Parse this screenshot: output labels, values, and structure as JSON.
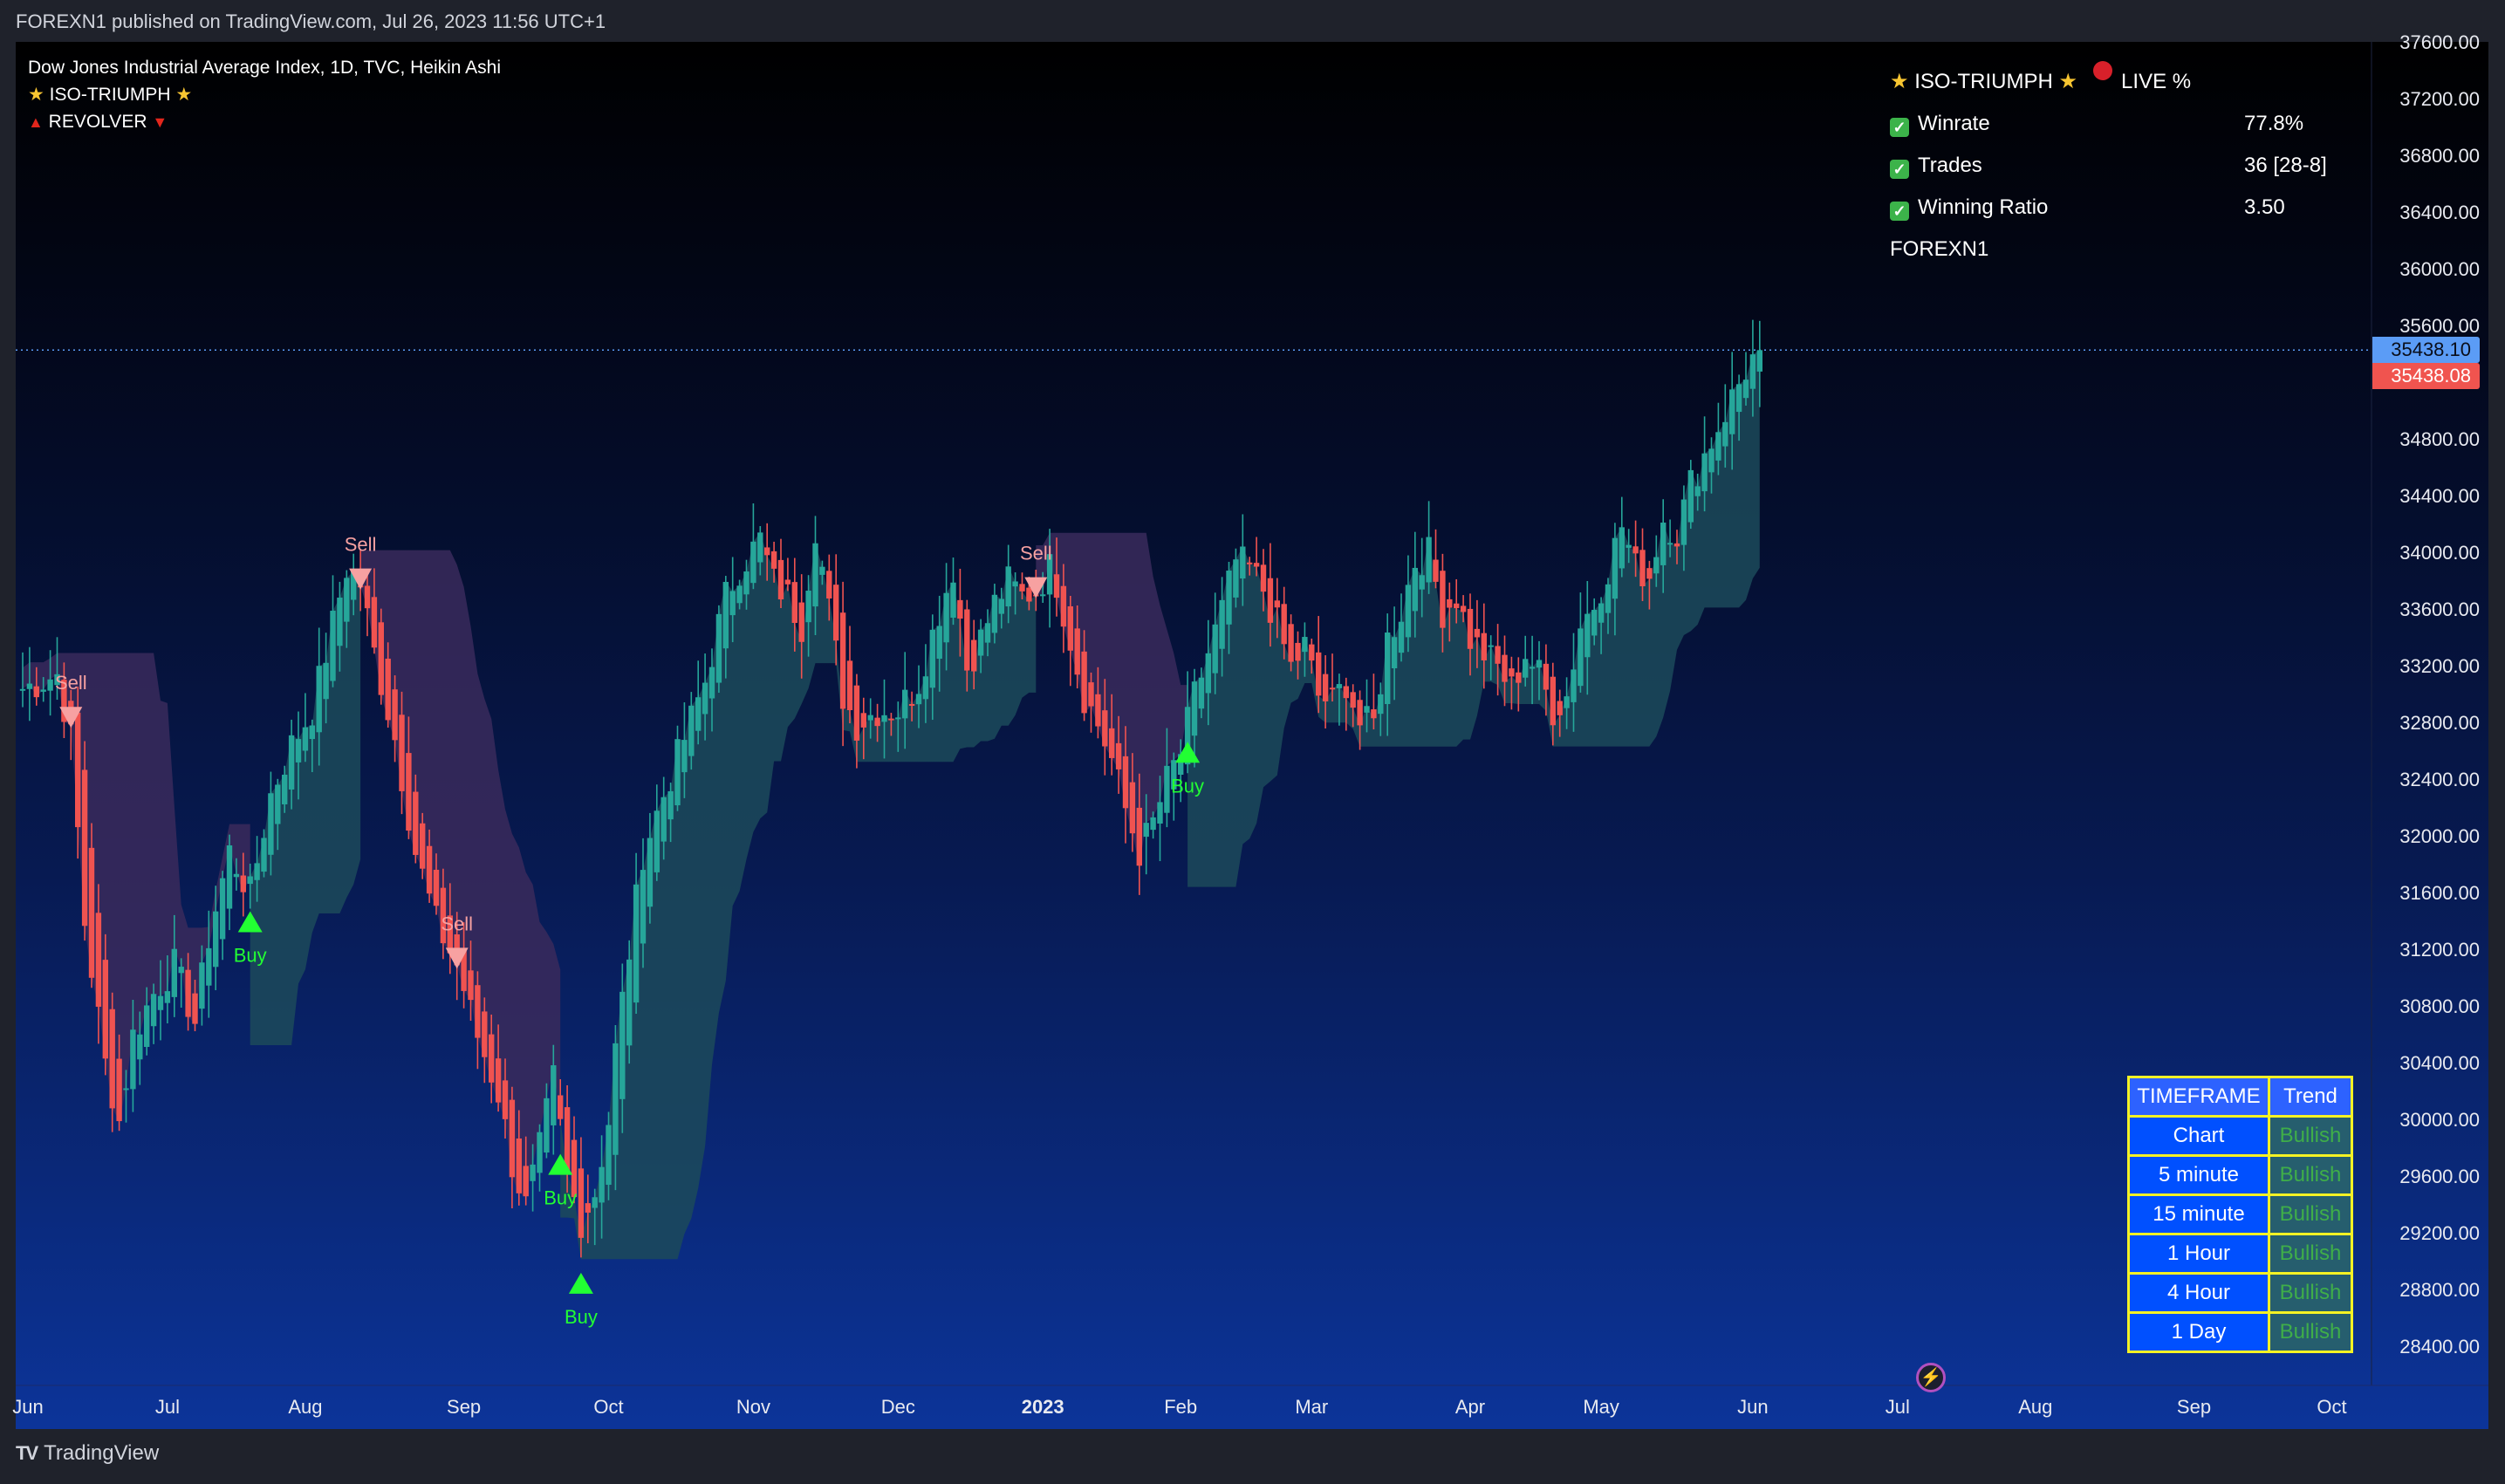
{
  "header": {
    "published": "FOREXN1 published on TradingView.com, Jul 26, 2023 11:56 UTC+1"
  },
  "legend": {
    "symbol": "Dow Jones Industrial Average Index, 1D, TVC, Heikin Ashi",
    "indicator1": "ISO-TRIUMPH",
    "indicator2": "REVOLVER"
  },
  "stats_panel": {
    "title": "ISO-TRIUMPH",
    "live_label": "LIVE %",
    "rows": [
      {
        "label": "Winrate",
        "value": "77.8%"
      },
      {
        "label": "Trades",
        "value": "36 [28-8]"
      },
      {
        "label": "Winning Ratio",
        "value": "3.50"
      }
    ],
    "author": "FOREXN1"
  },
  "trend_table": {
    "headers": [
      "TIMEFRAME",
      "Trend"
    ],
    "rows": [
      {
        "timeframe": "Chart",
        "trend": "Bullish"
      },
      {
        "timeframe": "5 minute",
        "trend": "Bullish"
      },
      {
        "timeframe": "15 minute",
        "trend": "Bullish"
      },
      {
        "timeframe": "1 Hour",
        "trend": "Bullish"
      },
      {
        "timeframe": "4 Hour",
        "trend": "Bullish"
      },
      {
        "timeframe": "1 Day",
        "trend": "Bullish"
      }
    ]
  },
  "price_badges": {
    "last": "35438.10",
    "last_color": "#5b9cf6",
    "ha_close": "35438.08",
    "ha_color": "#f0544f"
  },
  "footer": {
    "brand": "TradingView",
    "logo": "tv-logo-icon"
  },
  "colors": {
    "bull": "#26a69a",
    "bear": "#f05350",
    "sell_marker": "#f7a1a1",
    "buy_marker": "#22ff33",
    "bear_cloud": "#3a2a5c",
    "bull_cloud": "#1c4a5a",
    "table_border": "#f5f224"
  },
  "chart_data": {
    "type": "candlestick",
    "title": "Dow Jones Industrial Average Index, 1D, TVC, Heikin Ashi",
    "ylim": [
      28000,
      37700
    ],
    "y_ticks": [
      37600,
      37200,
      36800,
      36400,
      36000,
      35600,
      34800,
      34400,
      34000,
      33600,
      33200,
      32800,
      32400,
      32000,
      31600,
      31200,
      30800,
      30400,
      30000,
      29600,
      29200,
      28800,
      28400
    ],
    "y_tick_labels": [
      "37600.00",
      "37200.00",
      "36800.00",
      "36400.00",
      "36000.00",
      "35600.00",
      "34800.00",
      "34400.00",
      "34000.00",
      "33600.00",
      "33200.00",
      "32800.00",
      "32400.00",
      "32000.00",
      "31600.00",
      "31200.00",
      "30800.00",
      "30400.00",
      "30000.00",
      "29600.00",
      "29200.00",
      "28800.00",
      "28400.00"
    ],
    "x_labels": [
      {
        "label": "Jun",
        "bar": 0
      },
      {
        "label": "Jul",
        "bar": 21
      },
      {
        "label": "Aug",
        "bar": 41
      },
      {
        "label": "Sep",
        "bar": 64
      },
      {
        "label": "Oct",
        "bar": 85
      },
      {
        "label": "Nov",
        "bar": 106
      },
      {
        "label": "Dec",
        "bar": 127
      },
      {
        "label": "2023",
        "bar": 148,
        "bold": true
      },
      {
        "label": "Feb",
        "bar": 168
      },
      {
        "label": "Mar",
        "bar": 187
      },
      {
        "label": "Apr",
        "bar": 210
      },
      {
        "label": "May",
        "bar": 229
      },
      {
        "label": "Jun",
        "bar": 251
      },
      {
        "label": "Jul",
        "bar": 272
      },
      {
        "label": "Aug",
        "bar": 292
      },
      {
        "label": "Sep",
        "bar": 315
      },
      {
        "label": "Oct",
        "bar": 335
      }
    ],
    "total_bars": 345,
    "close_path": [
      [
        0,
        33050
      ],
      [
        5,
        33150
      ],
      [
        7,
        32700
      ],
      [
        9,
        31400
      ],
      [
        12,
        30400
      ],
      [
        14,
        30000
      ],
      [
        16,
        30600
      ],
      [
        19,
        30900
      ],
      [
        22,
        31100
      ],
      [
        25,
        30700
      ],
      [
        27,
        31300
      ],
      [
        30,
        31900
      ],
      [
        33,
        31600
      ],
      [
        36,
        32300
      ],
      [
        39,
        32650
      ],
      [
        42,
        32900
      ],
      [
        45,
        33500
      ],
      [
        47,
        33900
      ],
      [
        49,
        33800
      ],
      [
        51,
        33300
      ],
      [
        54,
        32700
      ],
      [
        57,
        31900
      ],
      [
        60,
        31400
      ],
      [
        63,
        31100
      ],
      [
        66,
        30600
      ],
      [
        69,
        30200
      ],
      [
        71,
        29700
      ],
      [
        73,
        29400
      ],
      [
        75,
        29800
      ],
      [
        77,
        30300
      ],
      [
        79,
        29600
      ],
      [
        81,
        29300
      ],
      [
        83,
        29500
      ],
      [
        85,
        30000
      ],
      [
        86,
        30500
      ],
      [
        88,
        31200
      ],
      [
        90,
        31900
      ],
      [
        93,
        32300
      ],
      [
        96,
        32700
      ],
      [
        99,
        33100
      ],
      [
        102,
        33700
      ],
      [
        104,
        33900
      ],
      [
        107,
        34100
      ],
      [
        109,
        33800
      ],
      [
        111,
        33700
      ],
      [
        113,
        33500
      ],
      [
        115,
        34200
      ],
      [
        117,
        33600
      ],
      [
        119,
        33000
      ],
      [
        121,
        32800
      ],
      [
        124,
        32900
      ],
      [
        127,
        32900
      ],
      [
        130,
        33100
      ],
      [
        133,
        33600
      ],
      [
        135,
        33900
      ],
      [
        137,
        33200
      ],
      [
        139,
        33400
      ],
      [
        141,
        33650
      ],
      [
        143,
        33800
      ],
      [
        145,
        33700
      ],
      [
        147,
        33750
      ],
      [
        149,
        33900
      ],
      [
        150,
        33800
      ],
      [
        152,
        33400
      ],
      [
        154,
        33000
      ],
      [
        156,
        32800
      ],
      [
        158,
        32550
      ],
      [
        160,
        32200
      ],
      [
        162,
        31900
      ],
      [
        164,
        32100
      ],
      [
        166,
        32400
      ],
      [
        168,
        32600
      ],
      [
        170,
        33000
      ],
      [
        172,
        33300
      ],
      [
        174,
        33600
      ],
      [
        176,
        33950
      ],
      [
        178,
        33900
      ],
      [
        180,
        33750
      ],
      [
        182,
        33500
      ],
      [
        184,
        33200
      ],
      [
        186,
        33350
      ],
      [
        188,
        33000
      ],
      [
        190,
        32950
      ],
      [
        192,
        33100
      ],
      [
        194,
        32800
      ],
      [
        196,
        32800
      ],
      [
        198,
        33400
      ],
      [
        200,
        33600
      ],
      [
        202,
        33950
      ],
      [
        204,
        34000
      ],
      [
        206,
        33600
      ],
      [
        208,
        33700
      ],
      [
        210,
        33400
      ],
      [
        212,
        33300
      ],
      [
        214,
        33200
      ],
      [
        216,
        33050
      ],
      [
        218,
        33300
      ],
      [
        220,
        33150
      ],
      [
        222,
        32900
      ],
      [
        224,
        33000
      ],
      [
        226,
        33500
      ],
      [
        228,
        33650
      ],
      [
        230,
        33900
      ],
      [
        232,
        34200
      ],
      [
        234,
        33900
      ],
      [
        236,
        33850
      ],
      [
        238,
        34250
      ],
      [
        240,
        34150
      ],
      [
        242,
        34500
      ],
      [
        244,
        34700
      ],
      [
        246,
        34900
      ],
      [
        248,
        35100
      ],
      [
        250,
        35300
      ],
      [
        252,
        35450
      ]
    ],
    "signals": [
      {
        "type": "Sell",
        "bar": 7
      },
      {
        "type": "Buy",
        "bar": 33
      },
      {
        "type": "Sell",
        "bar": 49
      },
      {
        "type": "Sell",
        "bar": 63
      },
      {
        "type": "Buy",
        "bar": 78
      },
      {
        "type": "Buy",
        "bar": 81
      },
      {
        "type": "Sell",
        "bar": 147
      },
      {
        "type": "Buy",
        "bar": 169
      }
    ],
    "last_price": 35438.1
  }
}
